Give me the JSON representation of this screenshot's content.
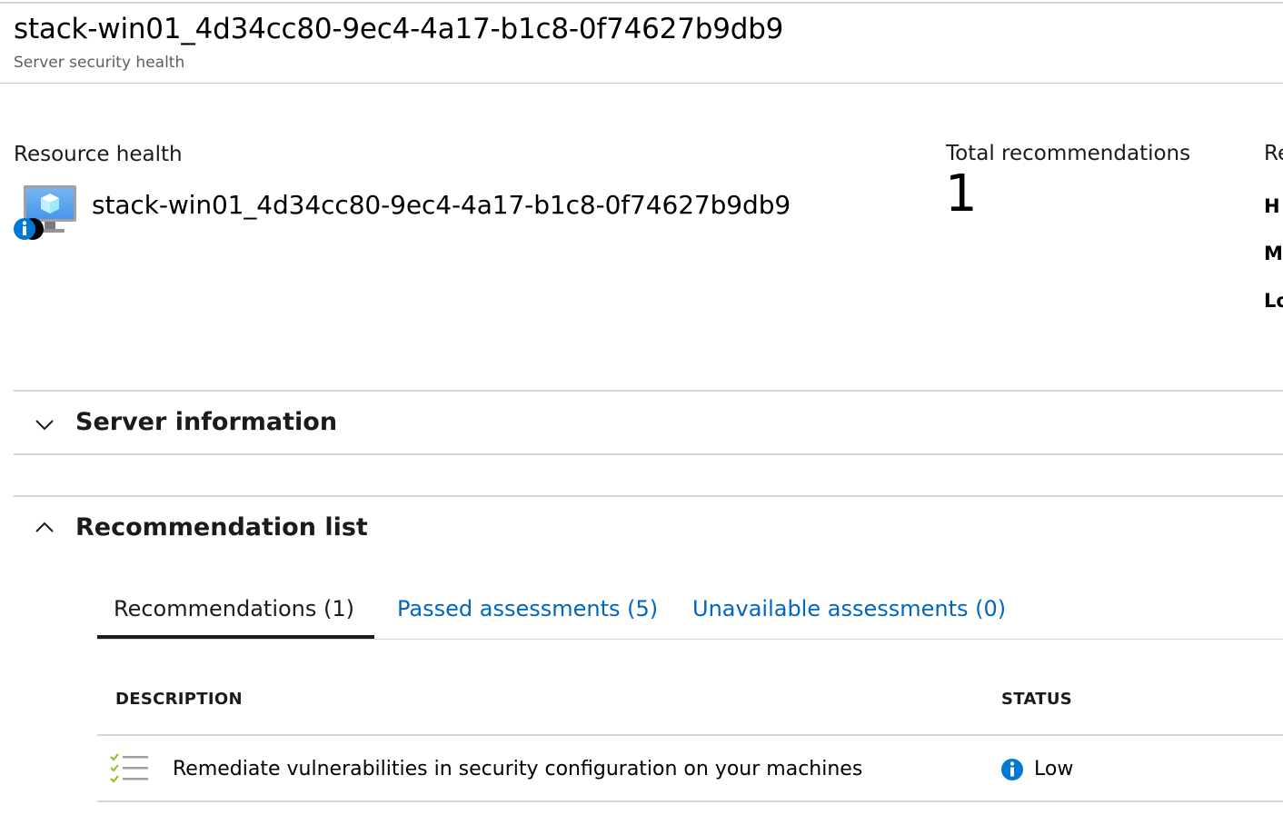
{
  "header": {
    "title": "stack-win01_4d34cc80-9ec4-4a17-b1c8-0f74627b9db9",
    "subtitle": "Server security health"
  },
  "resource_health": {
    "label": "Resource health",
    "resource_name": "stack-win01_4d34cc80-9ec4-4a17-b1c8-0f74627b9db9",
    "resource_icon": "virtual-machine-icon",
    "status_icon": "info-icon"
  },
  "summary": {
    "total_label": "Total recommendations",
    "total_value": "1",
    "severity_header_partial": "Re",
    "severity_rows_partial": [
      "H",
      "M",
      "Lo"
    ]
  },
  "sections": {
    "server_information": {
      "label": "Server information",
      "expanded": false,
      "icon": "chevron-down-icon"
    },
    "recommendation_list": {
      "label": "Recommendation list",
      "expanded": true,
      "icon": "chevron-up-icon"
    }
  },
  "tabs": [
    {
      "label": "Recommendations (1)",
      "active": true
    },
    {
      "label": "Passed assessments (5)",
      "active": false
    },
    {
      "label": "Unavailable assessments (0)",
      "active": false
    }
  ],
  "table": {
    "columns": [
      "DESCRIPTION",
      "STATUS"
    ],
    "rows": [
      {
        "icon": "checklist-icon",
        "description": "Remediate vulnerabilities in security configuration on your machines",
        "status_icon": "info-icon",
        "status": "Low"
      }
    ]
  },
  "colors": {
    "link": "#0066c0",
    "info_icon": "#0078d4",
    "divider": "#d6d6d6",
    "checklist_check": "#8cbf26"
  }
}
